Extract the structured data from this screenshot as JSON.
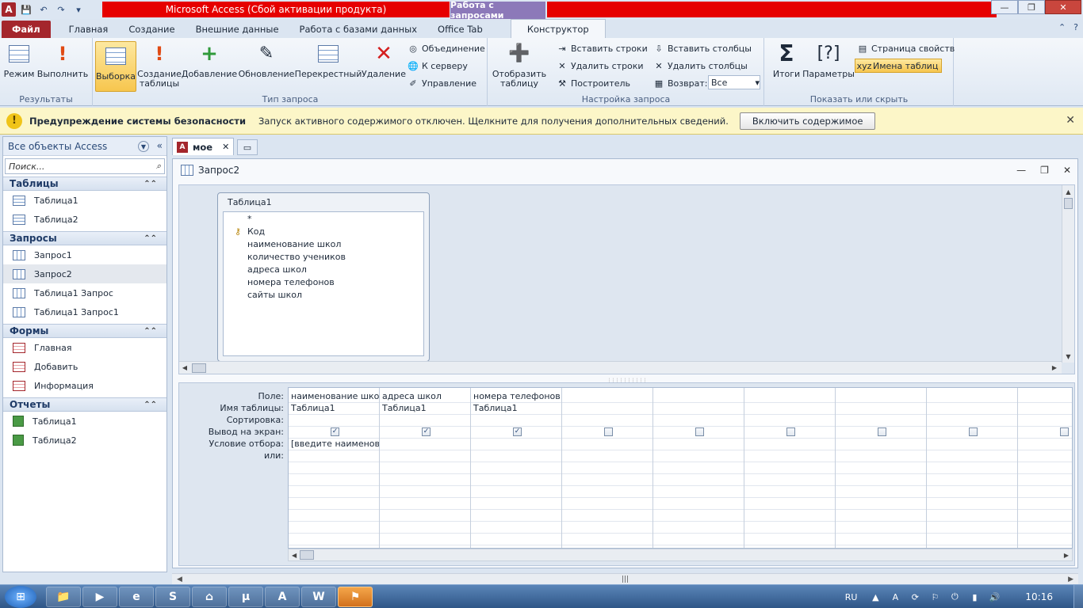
{
  "title_bar": {
    "title": "Microsoft Access (Сбой активации продукта)",
    "context_tab": "Работа с запросами",
    "minimize": "—",
    "restore": "❐",
    "close": "✕"
  },
  "tabs": {
    "file": "Файл",
    "home": "Главная",
    "create": "Создание",
    "external": "Внешние данные",
    "database": "Работа с базами данных",
    "officetab": "Office Tab",
    "design": "Конструктор"
  },
  "ribbon": {
    "results": {
      "label": "Результаты",
      "view": "Режим",
      "run": "Выполнить"
    },
    "query_type": {
      "label": "Тип запроса",
      "select": "Выборка",
      "make_table_1": "Создание",
      "make_table_2": "таблицы",
      "append": "Добавление",
      "update": "Обновление",
      "crosstab": "Перекрестный",
      "delete": "Удаление",
      "union": "Объединение",
      "passthrough": "К серверу",
      "ddl": "Управление"
    },
    "setup": {
      "show_table_1": "Отобразить",
      "show_table_2": "таблицу",
      "insert_rows": "Вставить строки",
      "delete_rows": "Удалить строки",
      "builder": "Построитель",
      "insert_cols": "Вставить столбцы",
      "delete_cols": "Удалить столбцы",
      "return_label": "Возврат:",
      "return_value": "Все",
      "label": "Настройка запроса"
    },
    "showhide": {
      "label": "Показать или скрыть",
      "totals": "Итоги",
      "parameters": "Параметры",
      "property_sheet": "Страница свойств",
      "table_names": "Имена таблиц"
    }
  },
  "security": {
    "title": "Предупреждение системы безопасности",
    "message": "Запуск активного содержимого отключен. Щелкните для получения дополнительных сведений.",
    "button": "Включить содержимое"
  },
  "nav": {
    "header": "Все объекты Access",
    "search_placeholder": "Поиск...",
    "sections": [
      {
        "title": "Таблицы",
        "items": [
          "Таблица1",
          "Таблица2"
        ]
      },
      {
        "title": "Запросы",
        "items": [
          "Запрос1",
          "Запрос2",
          "Таблица1 Запрос",
          "Таблица1 Запрос1"
        ]
      },
      {
        "title": "Формы",
        "items": [
          "Главная",
          "Добавить",
          "Информация"
        ]
      },
      {
        "title": "Отчеты",
        "items": [
          "Таблица1",
          "Таблица2"
        ]
      }
    ]
  },
  "doc_tab": {
    "name": "мое"
  },
  "query": {
    "title": "Запрос2",
    "table_box": {
      "title": "Таблица1",
      "fields": [
        "*",
        "Код",
        "наименование школ",
        "количество учеников",
        "адреса школ",
        "номера телефонов",
        "сайты школ"
      ]
    },
    "row_labels": [
      "Поле:",
      "Имя таблицы:",
      "Сортировка:",
      "Вывод на экран:",
      "Условие отбора:",
      "или:"
    ],
    "columns": [
      {
        "field": "наименование школ",
        "table": "Таблица1",
        "criteria": "[введите наименование]",
        "show": true
      },
      {
        "field": "адреса школ",
        "table": "Таблица1",
        "criteria": "",
        "show": true
      },
      {
        "field": "номера телефонов",
        "table": "Таблица1",
        "criteria": "",
        "show": true
      },
      {
        "field": "",
        "table": "",
        "criteria": "",
        "show": false
      },
      {
        "field": "",
        "table": "",
        "criteria": "",
        "show": false
      },
      {
        "field": "",
        "table": "",
        "criteria": "",
        "show": false
      },
      {
        "field": "",
        "table": "",
        "criteria": "",
        "show": false
      },
      {
        "field": "",
        "table": "",
        "criteria": "",
        "show": false
      },
      {
        "field": "",
        "table": "",
        "criteria": "",
        "show": false
      }
    ]
  },
  "taskbar": {
    "lang": "RU",
    "time": "10:16"
  }
}
